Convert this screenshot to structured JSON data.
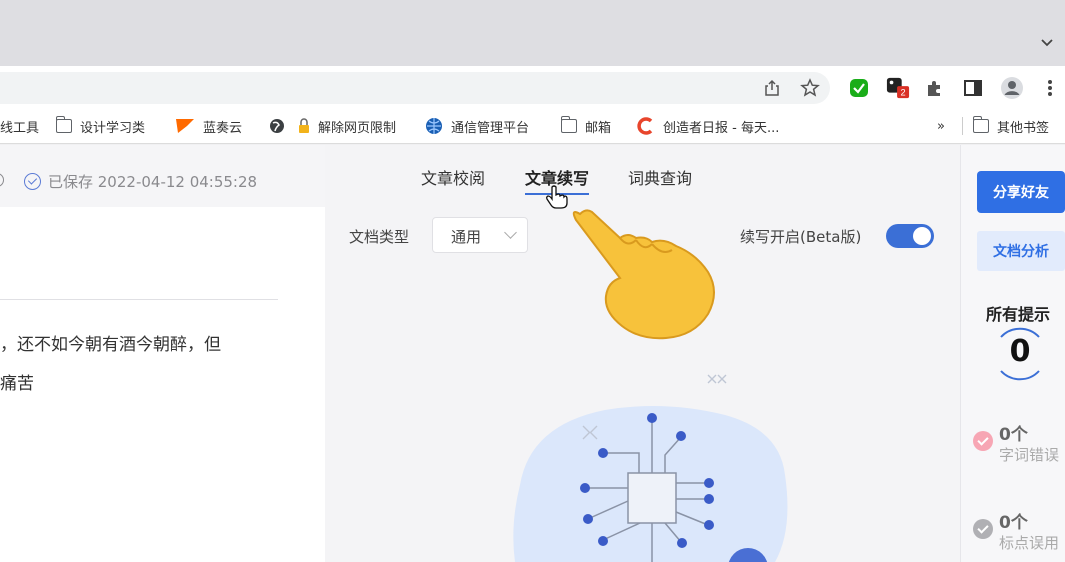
{
  "toolbar": {
    "icons": [
      "share-icon",
      "star-icon",
      "extension-green-icon",
      "extension-red-badge-icon",
      "puzzle-icon",
      "side-panel-icon",
      "profile-icon",
      "more-icon"
    ],
    "badge_count": "2"
  },
  "bookmarks": {
    "items": [
      {
        "label": "线工具",
        "icon": "folder-icon"
      },
      {
        "label": "设计学习类",
        "icon": "folder-icon"
      },
      {
        "label": "蓝奏云",
        "icon": "flag-icon"
      },
      {
        "label": "",
        "icon": "globe-icon"
      },
      {
        "label": "解除网页限制",
        "icon": "lock-icon"
      },
      {
        "label": "通信管理平台",
        "icon": "globe-blue-icon"
      },
      {
        "label": "邮箱",
        "icon": "folder-icon"
      },
      {
        "label": "创造者日报 - 每天...",
        "icon": "c-logo-icon"
      }
    ],
    "overflow": "»",
    "other": "其他书签"
  },
  "editor": {
    "saved_text": "已保存 2022-04-12 04:55:28",
    "paragraph": [
      "，还不如今朝有酒今朝醉，但",
      "痛苦"
    ]
  },
  "tabs": [
    {
      "label": "文章校阅",
      "active": false
    },
    {
      "label": "文章续写",
      "active": true
    },
    {
      "label": "词典查询",
      "active": false
    }
  ],
  "options": {
    "doctype_label": "文档类型",
    "doctype_value": "通用",
    "continue_label": "续写开启(Beta版)",
    "continue_enabled": true
  },
  "sidebar": {
    "share_label": "分享好友",
    "analysis_label": "文档分析",
    "hints_title": "所有提示",
    "hints_count": "0",
    "stats": [
      {
        "count": "0个",
        "label": "字词错误",
        "color": "#f7a6b4"
      },
      {
        "count": "0个",
        "label": "标点误用",
        "color": "#b0b0b4"
      }
    ]
  },
  "colors": {
    "accent": "#2f6fe4",
    "toggle_on": "#3b6fd6"
  }
}
